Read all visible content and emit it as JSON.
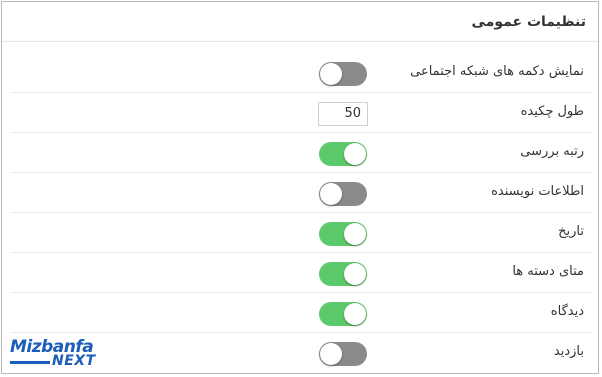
{
  "panel": {
    "title": "تنظیمات عمومی"
  },
  "settings": [
    {
      "label": "نمایش دکمه های شبکه اجتماعی",
      "type": "toggle",
      "on": false
    },
    {
      "label": "طول چکیده",
      "type": "number",
      "value": "50"
    },
    {
      "label": "رتبه بررسی",
      "type": "toggle",
      "on": true
    },
    {
      "label": "اطلاعات نویسنده",
      "type": "toggle",
      "on": false
    },
    {
      "label": "تاریخ",
      "type": "toggle",
      "on": true
    },
    {
      "label": "متای دسته ها",
      "type": "toggle",
      "on": true
    },
    {
      "label": "دیدگاه",
      "type": "toggle",
      "on": true
    },
    {
      "label": "بازدید",
      "type": "toggle",
      "on": false
    }
  ],
  "colors": {
    "toggle_on": "#5cc96a",
    "toggle_off": "#8a8a8a",
    "brand": "#1b5db8"
  },
  "watermark": {
    "brand": "Mizbanfa",
    "sub": "NEXT"
  }
}
